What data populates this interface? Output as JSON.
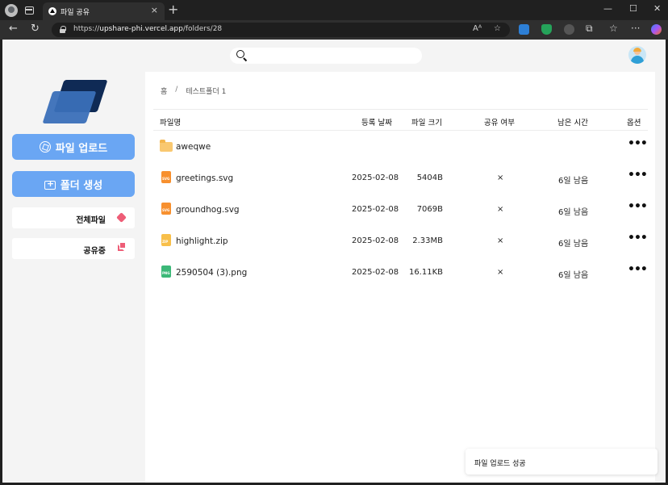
{
  "browser": {
    "tab_title": "파일 공유",
    "tab_close": "×",
    "new_tab": "+",
    "url_scheme": "https://",
    "url_host": "upshare-phi.vercel.app",
    "url_path": "/folders/28",
    "window_controls": {
      "minimize": "—",
      "maximize": "☐",
      "close": "✕"
    },
    "nav": {
      "back": "←",
      "refresh": "↻"
    },
    "addr_icons": {
      "read_aloud": "Aᴬ",
      "favorite": "☆"
    },
    "toolbar_icons": {
      "extensions": "⧉",
      "favorites": "☆",
      "menu": "···"
    }
  },
  "sidebar": {
    "upload_label": "파일 업로드",
    "create_folder_label": "폴더 생성",
    "all_files_label": "전체파일",
    "shared_label": "공유중",
    "colors": {
      "button": "#6aa6f3",
      "nav_icon": "#ee5d77"
    }
  },
  "breadcrumb": {
    "home": "홈",
    "separator": "/",
    "current": "테스트폴더 1"
  },
  "table": {
    "headers": {
      "name": "파일명",
      "date": "등록 날짜",
      "size": "파일 크기",
      "shared": "공유 여부",
      "remaining": "남은 시간",
      "options": "옵션"
    },
    "rows": [
      {
        "type": "folder",
        "icon": "folder-icon",
        "name": "aweqwe",
        "date": "",
        "size": "",
        "shared": "",
        "remaining": "",
        "options": "•••"
      },
      {
        "type": "file",
        "icon": "svg-file-icon",
        "icon_color": "#f7902f",
        "icon_tag": "SVG",
        "name": "greetings.svg",
        "date": "2025-02-08",
        "size": "5404B",
        "shared": "×",
        "remaining": "6일 남음",
        "options": "•••"
      },
      {
        "type": "file",
        "icon": "svg-file-icon",
        "icon_color": "#f7902f",
        "icon_tag": "SVG",
        "name": "groundhog.svg",
        "date": "2025-02-08",
        "size": "7069B",
        "shared": "×",
        "remaining": "6일 남음",
        "options": "•••"
      },
      {
        "type": "file",
        "icon": "zip-file-icon",
        "icon_color": "#f8bf4a",
        "icon_tag": "ZIP",
        "name": "highlight.zip",
        "date": "2025-02-08",
        "size": "2.33MB",
        "shared": "×",
        "remaining": "6일 남음",
        "options": "•••"
      },
      {
        "type": "file",
        "icon": "image-file-icon",
        "icon_color": "#3cb878",
        "icon_tag": "PNG",
        "name": "2590504 (3).png",
        "date": "2025-02-08",
        "size": "16.11KB",
        "shared": "×",
        "remaining": "6일 남음",
        "options": "•••"
      }
    ]
  },
  "toast": {
    "message": "파일 업로드 성공"
  }
}
